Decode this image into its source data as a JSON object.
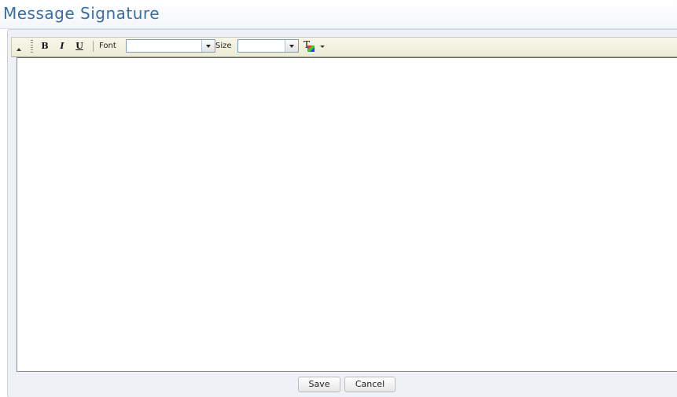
{
  "page": {
    "title": "Message Signature"
  },
  "toolbar": {
    "bold_label": "B",
    "italic_label": "I",
    "underline_label": "U",
    "font_label": "Font",
    "font_value": "",
    "size_label": "Size",
    "size_value": "",
    "text_color_label": "T"
  },
  "editor": {
    "content": ""
  },
  "actions": {
    "save_label": "Save",
    "cancel_label": "Cancel"
  },
  "colors": {
    "title": "#3a6ea5",
    "toolbar_background": "#ebecd6",
    "panel_background": "#eef2f7"
  },
  "icons": [
    "collapse-icon",
    "toolbar-grip-icon",
    "text-color-icon",
    "chevron-down-icon"
  ]
}
